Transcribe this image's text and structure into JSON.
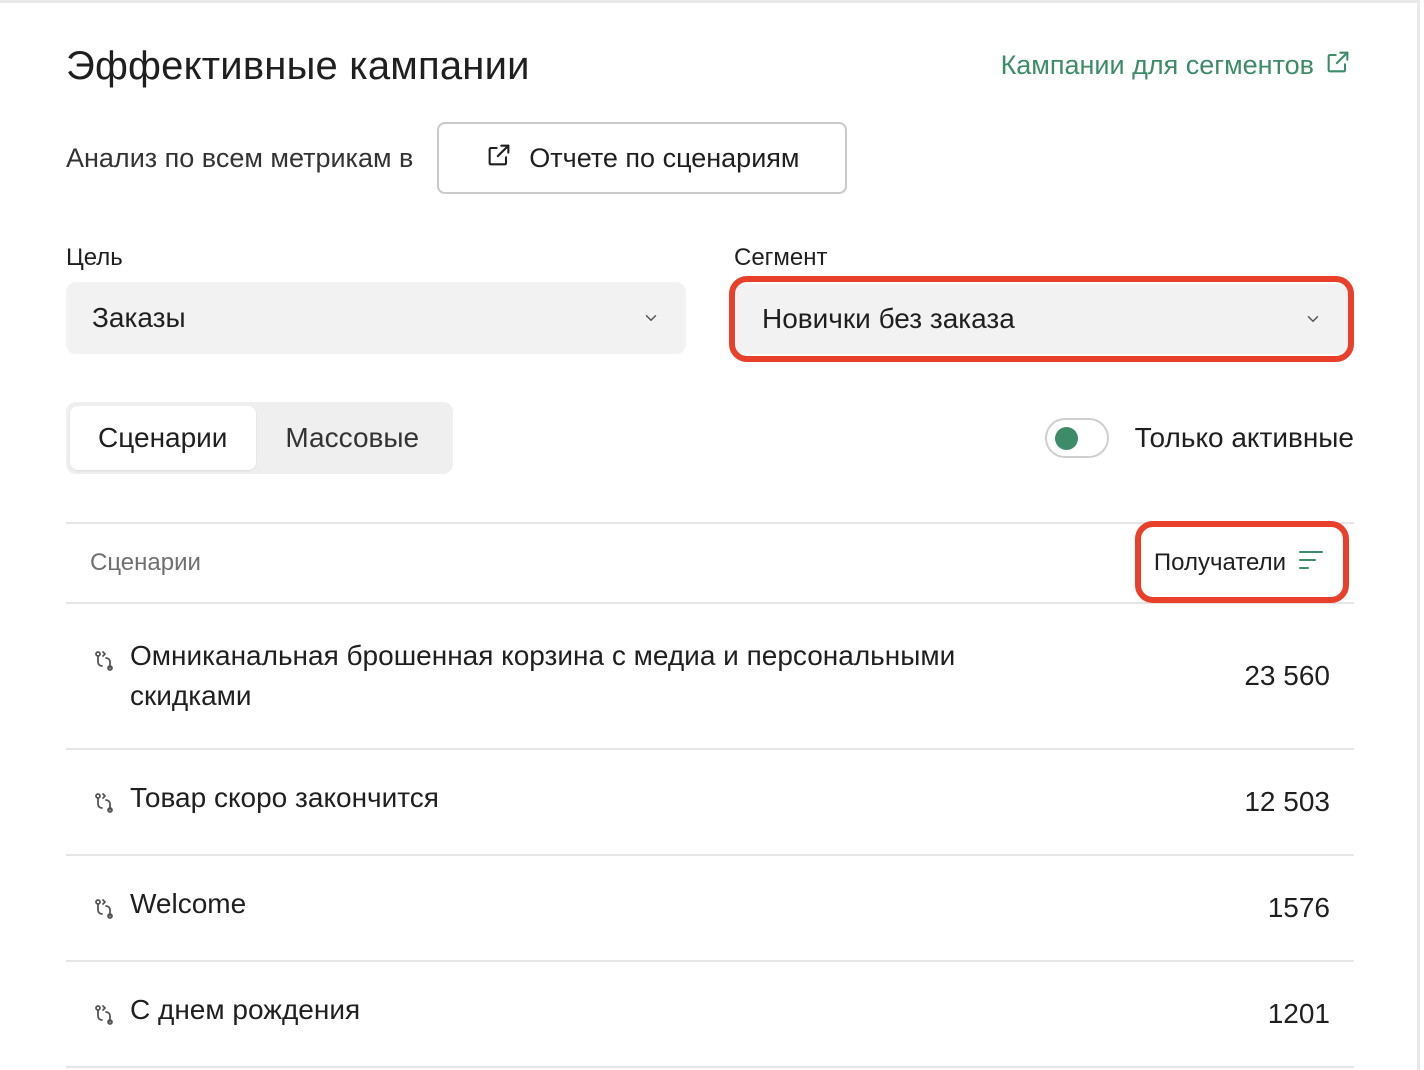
{
  "header": {
    "title": "Эффективные кампании",
    "segments_link": "Кампании для сегментов"
  },
  "analysis": {
    "text": "Анализ по всем метрикам в",
    "report_button": "Отчете по сценариям"
  },
  "filters": {
    "goal": {
      "label": "Цель",
      "value": "Заказы"
    },
    "segment": {
      "label": "Сегмент",
      "value": "Новички без заказа"
    }
  },
  "tabs": [
    {
      "label": "Сценарии",
      "active": true
    },
    {
      "label": "Массовые",
      "active": false
    }
  ],
  "toggle": {
    "label": "Только активные",
    "on": true
  },
  "table": {
    "columns": {
      "name": "Сценарии",
      "recipients": "Получатели"
    },
    "rows": [
      {
        "name": "Омниканальная брошенная корзина с медиа и персональными скидками",
        "recipients": "23 560"
      },
      {
        "name": "Товар скоро закончится",
        "recipients": "12 503"
      },
      {
        "name": "Welcome",
        "recipients": "1576"
      },
      {
        "name": "С днем рождения",
        "recipients": "1201"
      }
    ]
  },
  "colors": {
    "accent": "#3d8b68",
    "highlight": "#e8402a"
  }
}
